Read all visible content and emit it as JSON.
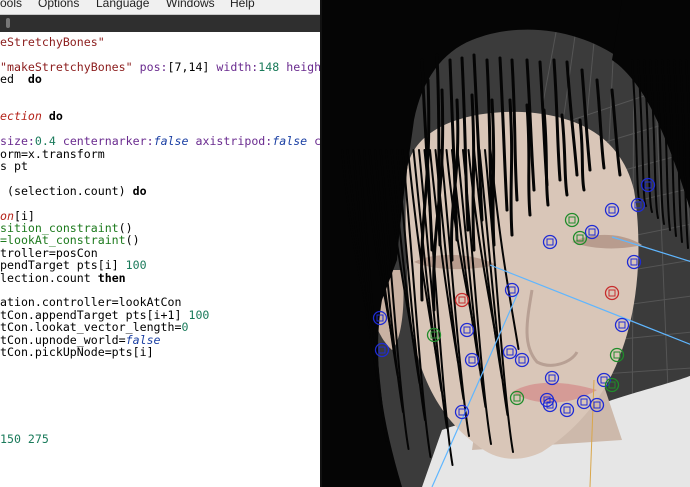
{
  "menu": {
    "items": [
      "ools",
      "Options",
      "Language",
      "Windows",
      "Help"
    ]
  },
  "editor": {
    "lines": [
      {
        "parts": [
          {
            "t": "eStretchyBones\"",
            "c": "str"
          }
        ]
      },
      {
        "parts": []
      },
      {
        "parts": [
          {
            "t": "\"makeStretchyBones\"",
            "c": "str"
          },
          {
            "t": " pos:",
            "c": "lbl"
          },
          {
            "t": "[7,14]",
            "c": "op"
          },
          {
            "t": " width:",
            "c": "lbl"
          },
          {
            "t": "148",
            "c": "num"
          },
          {
            "t": " heigh",
            "c": "lbl"
          }
        ]
      },
      {
        "parts": [
          {
            "t": "ed  ",
            "c": "op"
          },
          {
            "t": "do",
            "c": "kw"
          }
        ]
      },
      {
        "parts": []
      },
      {
        "parts": []
      },
      {
        "parts": [
          {
            "t": "ection",
            "c": "red"
          },
          {
            "t": " ",
            "c": "op"
          },
          {
            "t": "do",
            "c": "kw"
          }
        ]
      },
      {
        "parts": []
      },
      {
        "parts": [
          {
            "t": "size:",
            "c": "lbl"
          },
          {
            "t": "0.4",
            "c": "num"
          },
          {
            "t": " centernarker:",
            "c": "lbl"
          },
          {
            "t": "false",
            "c": "ital"
          },
          {
            "t": " axistripod:",
            "c": "lbl"
          },
          {
            "t": "false",
            "c": "ital"
          },
          {
            "t": " c",
            "c": "lbl"
          }
        ]
      },
      {
        "parts": [
          {
            "t": "orm=x.transform",
            "c": "op"
          }
        ]
      },
      {
        "parts": [
          {
            "t": "s pt",
            "c": "op"
          }
        ]
      },
      {
        "parts": []
      },
      {
        "parts": [
          {
            "t": " (selection.count) ",
            "c": "op"
          },
          {
            "t": "do",
            "c": "kw"
          }
        ]
      },
      {
        "parts": []
      },
      {
        "parts": [
          {
            "t": "on",
            "c": "red"
          },
          {
            "t": "[i]",
            "c": "op"
          }
        ]
      },
      {
        "parts": [
          {
            "t": "sition_constraint",
            "c": "fn"
          },
          {
            "t": "()",
            "c": "op"
          }
        ]
      },
      {
        "parts": [
          {
            "t": "=lookAt_constraint",
            "c": "fn"
          },
          {
            "t": "()",
            "c": "op"
          }
        ]
      },
      {
        "parts": [
          {
            "t": "troller=posCon",
            "c": "op"
          }
        ]
      },
      {
        "parts": [
          {
            "t": "pendTarget pts[i] ",
            "c": "op"
          },
          {
            "t": "100",
            "c": "num"
          }
        ]
      },
      {
        "parts": [
          {
            "t": "lection.count ",
            "c": "op"
          },
          {
            "t": "then",
            "c": "kw"
          }
        ]
      },
      {
        "parts": []
      },
      {
        "parts": [
          {
            "t": "ation.controller=lookAtCon",
            "c": "op"
          }
        ]
      },
      {
        "parts": [
          {
            "t": "tCon.appendTarget pts[i+1] ",
            "c": "op"
          },
          {
            "t": "100",
            "c": "num"
          }
        ]
      },
      {
        "parts": [
          {
            "t": "tCon.lookat_vector_length=",
            "c": "op"
          },
          {
            "t": "0",
            "c": "num"
          }
        ]
      },
      {
        "parts": [
          {
            "t": "tCon.upnode_world=",
            "c": "op"
          },
          {
            "t": "false",
            "c": "ital"
          }
        ]
      },
      {
        "parts": [
          {
            "t": "tCon.pickUpNode=pts[i]",
            "c": "op"
          }
        ]
      },
      {
        "parts": []
      },
      {
        "parts": []
      },
      {
        "parts": []
      },
      {
        "parts": []
      },
      {
        "parts": []
      },
      {
        "parts": []
      },
      {
        "parts": [
          {
            "t": "150 275",
            "c": "num"
          }
        ]
      }
    ]
  },
  "viewport": {
    "colors": {
      "background": "#3b3b3b",
      "grid": "#555555",
      "skin": "#d9c6b8",
      "hair": "#050505",
      "marker_blue": "#1e2bd6",
      "marker_green": "#1f8c2a",
      "marker_red": "#c72c2c",
      "lookat_line": "#5fb6ff",
      "shirt": "#e6e6e6"
    }
  }
}
